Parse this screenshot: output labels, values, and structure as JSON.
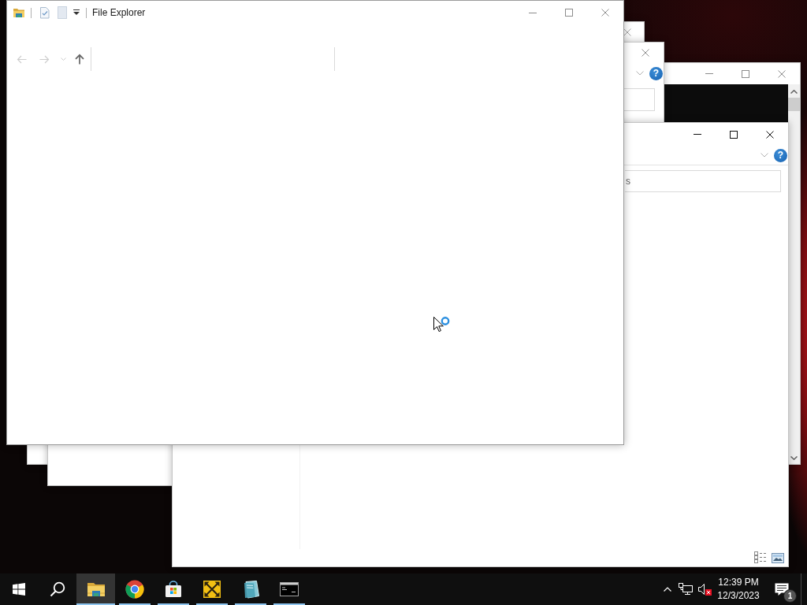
{
  "background_windows": [
    {
      "kind": "blank"
    },
    {
      "kind": "console"
    },
    {
      "kind": "ribbon",
      "help": "?"
    },
    {
      "kind": "explorer",
      "help": "?",
      "search": {
        "placeholder": "s"
      },
      "view_buttons": [
        {
          "kind": "details"
        },
        {
          "kind": "tiles"
        }
      ]
    }
  ],
  "file_explorer": {
    "title": "File Explorer",
    "nav_buttons": [
      {
        "kind": "back",
        "disabled": true
      },
      {
        "kind": "forward",
        "disabled": true
      },
      {
        "kind": "recent",
        "disabled": true
      },
      {
        "kind": "up",
        "disabled": false
      }
    ]
  },
  "taskbar": {
    "apps": [
      {
        "kind": "folder",
        "selected": true,
        "running": true
      },
      {
        "kind": "browser",
        "selected": false,
        "running": true
      },
      {
        "kind": "store",
        "selected": false,
        "running": true
      },
      {
        "kind": "arrows",
        "selected": false,
        "running": true
      },
      {
        "kind": "notepad",
        "selected": false,
        "running": true
      },
      {
        "kind": "console",
        "selected": false,
        "running": true
      }
    ],
    "tray": {
      "volume": {
        "muted": true
      }
    },
    "clock": {
      "time": "12:39 PM",
      "date": "12/3/2023"
    },
    "notifications": {
      "count": "1"
    }
  }
}
